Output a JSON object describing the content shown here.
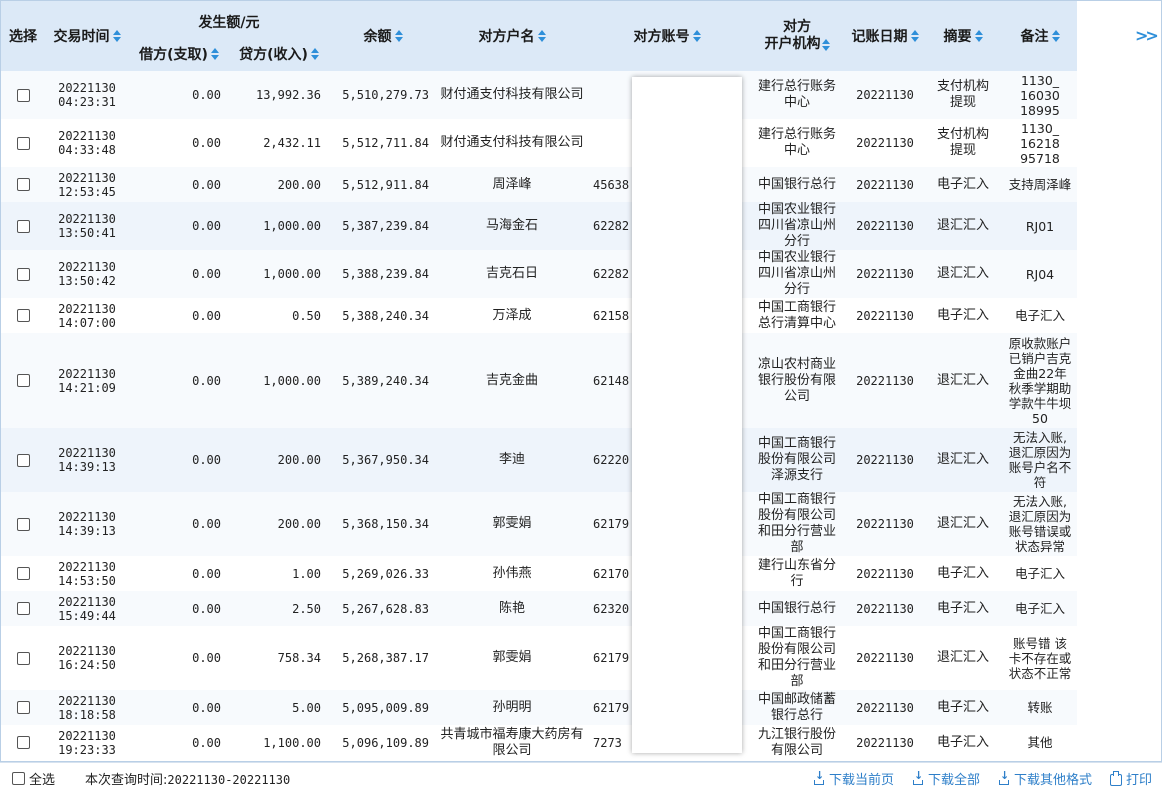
{
  "header": {
    "select": "选择",
    "trade_time": "交易时间",
    "amount_group": "发生额/元",
    "debit": "借方(支取)",
    "credit": "贷方(收入)",
    "balance": "余额",
    "counterparty_name": "对方户名",
    "counterparty_account": "对方账号",
    "counterparty_bank_line1": "对方",
    "counterparty_bank_line2": "开户机构",
    "book_date": "记账日期",
    "summary": "摘要",
    "remark": "备注",
    "more": ">>"
  },
  "rows": [
    {
      "date": "20221130",
      "time": "04:23:31",
      "debit": "0.00",
      "credit": "13,992.36",
      "balance": "5,510,279.73",
      "name": "财付通支付科技有限公司",
      "account": "",
      "bank": "建行总行账务中心",
      "book_date": "20221130",
      "summary": "支付机构提现",
      "remark_lines": [
        "1130_",
        "16030",
        "18995"
      ]
    },
    {
      "date": "20221130",
      "time": "04:33:48",
      "debit": "0.00",
      "credit": "2,432.11",
      "balance": "5,512,711.84",
      "name": "财付通支付科技有限公司",
      "account": "",
      "bank": "建行总行账务中心",
      "book_date": "20221130",
      "summary": "支付机构提现",
      "remark_lines": [
        "1130_",
        "16218",
        "95718"
      ]
    },
    {
      "date": "20221130",
      "time": "12:53:45",
      "debit": "0.00",
      "credit": "200.00",
      "balance": "5,512,911.84",
      "name": "周泽峰",
      "account": "45638",
      "bank": "中国银行总行",
      "book_date": "20221130",
      "summary": "电子汇入",
      "remark_lines": [
        "支持周泽峰"
      ]
    },
    {
      "date": "20221130",
      "time": "13:50:41",
      "debit": "0.00",
      "credit": "1,000.00",
      "balance": "5,387,239.84",
      "name": "马海金石",
      "account": "62282",
      "bank": "中国农业银行四川省凉山州分行",
      "book_date": "20221130",
      "summary": "退汇汇入",
      "remark_lines": [
        "RJ01"
      ]
    },
    {
      "date": "20221130",
      "time": "13:50:42",
      "debit": "0.00",
      "credit": "1,000.00",
      "balance": "5,388,239.84",
      "name": "吉克石日",
      "account": "62282",
      "bank": "中国农业银行四川省凉山州分行",
      "book_date": "20221130",
      "summary": "退汇汇入",
      "remark_lines": [
        "RJ04"
      ]
    },
    {
      "date": "20221130",
      "time": "14:07:00",
      "debit": "0.00",
      "credit": "0.50",
      "balance": "5,388,240.34",
      "name": "万泽成",
      "account": "62158",
      "bank": "中国工商银行总行清算中心",
      "book_date": "20221130",
      "summary": "电子汇入",
      "remark_lines": [
        "电子汇入"
      ]
    },
    {
      "date": "20221130",
      "time": "14:21:09",
      "debit": "0.00",
      "credit": "1,000.00",
      "balance": "5,389,240.34",
      "name": "吉克金曲",
      "account": "62148",
      "bank": "凉山农村商业银行股份有限公司",
      "book_date": "20221130",
      "summary": "退汇汇入",
      "remark_lines": [
        "原收款账户",
        "已销户吉克",
        "金曲22年",
        "秋季学期助",
        "学款牛牛坝",
        "50"
      ]
    },
    {
      "date": "20221130",
      "time": "14:39:13",
      "debit": "0.00",
      "credit": "200.00",
      "balance": "5,367,950.34",
      "name": "李迪",
      "account": "62220",
      "bank": "中国工商银行股份有限公司泽源支行",
      "book_date": "20221130",
      "summary": "退汇汇入",
      "remark_lines": [
        "无法入账,",
        "退汇原因为",
        "账号户名不",
        "符"
      ]
    },
    {
      "date": "20221130",
      "time": "14:39:13",
      "debit": "0.00",
      "credit": "200.00",
      "balance": "5,368,150.34",
      "name": "郭雯娟",
      "account": "62179",
      "bank": "中国工商银行股份有限公司和田分行营业部",
      "book_date": "20221130",
      "summary": "退汇汇入",
      "remark_lines": [
        "无法入账,",
        "退汇原因为",
        "账号错误或",
        "状态异常"
      ]
    },
    {
      "date": "20221130",
      "time": "14:53:50",
      "debit": "0.00",
      "credit": "1.00",
      "balance": "5,269,026.33",
      "name": "孙伟燕",
      "account": "62170",
      "bank": "建行山东省分行",
      "book_date": "20221130",
      "summary": "电子汇入",
      "remark_lines": [
        "电子汇入"
      ]
    },
    {
      "date": "20221130",
      "time": "15:49:44",
      "debit": "0.00",
      "credit": "2.50",
      "balance": "5,267,628.83",
      "name": "陈艳",
      "account": "62320",
      "bank": "中国银行总行",
      "book_date": "20221130",
      "summary": "电子汇入",
      "remark_lines": [
        "电子汇入"
      ]
    },
    {
      "date": "20221130",
      "time": "16:24:50",
      "debit": "0.00",
      "credit": "758.34",
      "balance": "5,268,387.17",
      "name": "郭雯娟",
      "account": "62179",
      "bank": "中国工商银行股份有限公司和田分行营业部",
      "book_date": "20221130",
      "summary": "退汇汇入",
      "remark_lines": [
        "账号错 该",
        "卡不存在或",
        "状态不正常"
      ]
    },
    {
      "date": "20221130",
      "time": "18:18:58",
      "debit": "0.00",
      "credit": "5.00",
      "balance": "5,095,009.89",
      "name": "孙明明",
      "account": "62179",
      "bank": "中国邮政储蓄银行总行",
      "book_date": "20221130",
      "summary": "电子汇入",
      "remark_lines": [
        "转账"
      ]
    },
    {
      "date": "20221130",
      "time": "19:23:33",
      "debit": "0.00",
      "credit": "1,100.00",
      "balance": "5,096,109.89",
      "name": "共青城市福寿康大药房有限公司",
      "account": "7273",
      "bank": "九江银行股份有限公司",
      "book_date": "20221130",
      "summary": "电子汇入",
      "remark_lines": [
        "其他"
      ]
    }
  ],
  "footer": {
    "select_all": "全选",
    "query_time_label": "本次查询时间:",
    "query_time_value": "20221130-20221130",
    "download_page": "下载当前页",
    "download_all": "下载全部",
    "download_other": "下载其他格式",
    "print": "打印"
  },
  "colors": {
    "header_bg": "#dce9f7",
    "accent": "#2e8fd9",
    "link": "#2e7fc9"
  }
}
